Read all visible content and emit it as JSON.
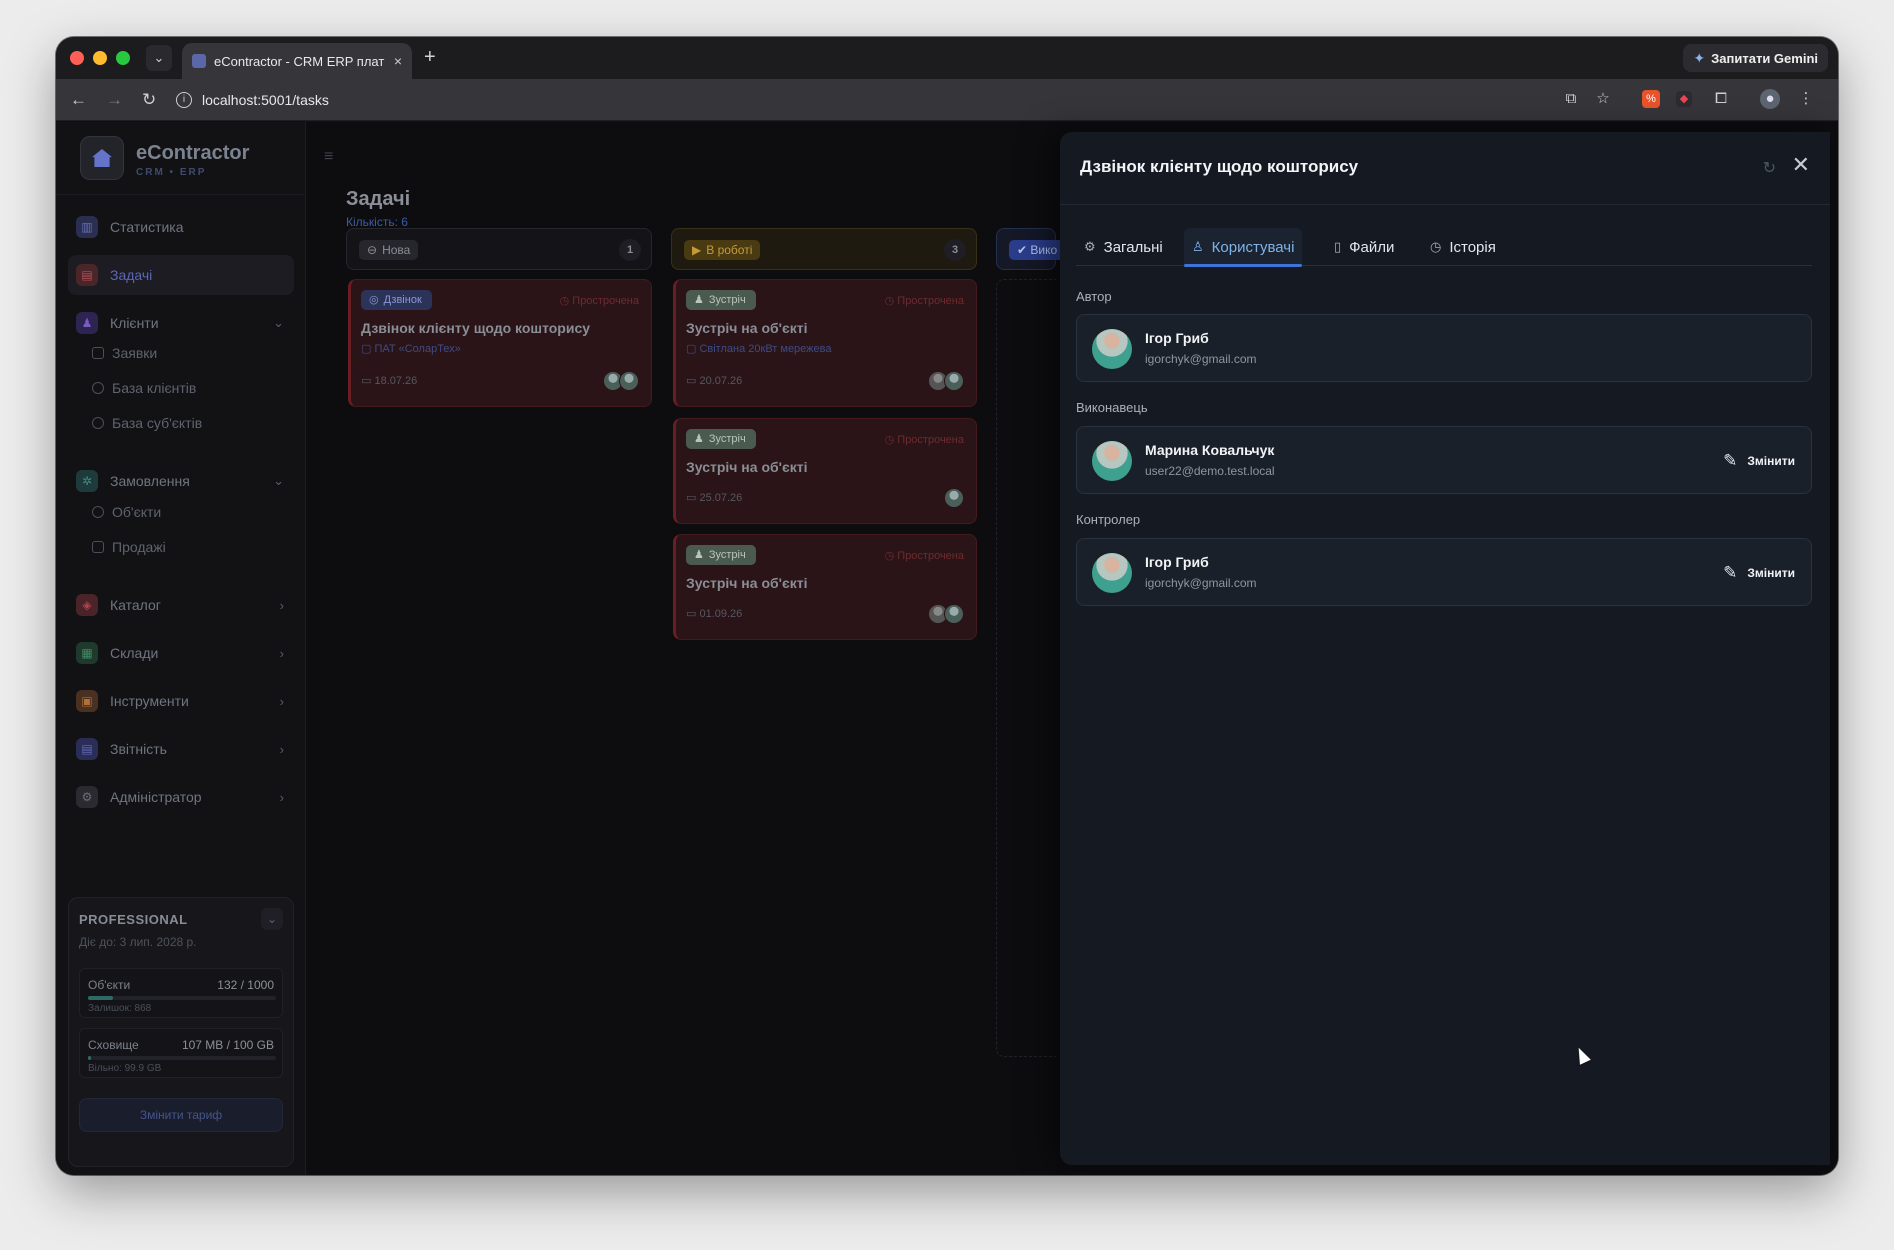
{
  "browser": {
    "tab_title": "eContractor - CRM ERP плат",
    "tab_close": "×",
    "new_tab": "+",
    "url": "localhost:5001/tasks",
    "gemini_label": "Запитати Gemini"
  },
  "sidebar": {
    "brand": "eContractor",
    "brand_sub": "CRM • ERP",
    "items": [
      {
        "label": "Статистика",
        "icon": "bar-chart-icon",
        "color": "#2a2f52"
      },
      {
        "label": "Задачі",
        "icon": "clipboard-icon",
        "color": "#4a2628"
      },
      {
        "label": "Клієнти",
        "icon": "users-icon",
        "color": "#2e2452"
      },
      {
        "label": "Замовлення",
        "icon": "gear-icon",
        "color": "#1e3a3a"
      },
      {
        "label": "Каталог",
        "icon": "box-icon",
        "color": "#4a2428"
      },
      {
        "label": "Склади",
        "icon": "warehouse-icon",
        "color": "#1f3a2c"
      },
      {
        "label": "Інструменти",
        "icon": "toolbox-icon",
        "color": "#4a3020"
      },
      {
        "label": "Звітність",
        "icon": "report-icon",
        "color": "#2a2d55"
      },
      {
        "label": "Адміністратор",
        "icon": "settings-icon",
        "color": "#2a2a30"
      }
    ],
    "clients_sub": [
      "Заявки",
      "База клієнтів",
      "База суб'єктів"
    ],
    "orders_sub": [
      "Об'єкти",
      "Продажі"
    ],
    "plan": {
      "name": "PROFESSIONAL",
      "expires": "Діє до: 3 лип. 2028 р.",
      "objects_label": "Об'єкти",
      "objects_value": "132 / 1000",
      "objects_fill": 0.132,
      "objects_rest": "Залишок: 868",
      "storage_label": "Сховище",
      "storage_value": "107 MB / 100 GB",
      "storage_fill": 0.001,
      "storage_rest": "Вільно: 99.9 GB",
      "button": "Змінити тариф"
    }
  },
  "board": {
    "title": "Задачі",
    "count": "Кількість: 6",
    "columns": [
      {
        "label": "Нова",
        "count": "1"
      },
      {
        "label": "В роботі",
        "count": "3"
      },
      {
        "label": "Вико"
      }
    ],
    "cards": [
      {
        "tag": "Дзвінок",
        "overdue": "Прострочена",
        "title": "Дзвінок клієнту щодо кошторису",
        "client": "ПАТ «СоларТех»",
        "date": "18.07.26"
      },
      {
        "tag": "Зустріч",
        "overdue": "Прострочена",
        "title": "Зустріч на об'єкті",
        "client": "Світлана 20кВт мережева",
        "date": "20.07.26"
      },
      {
        "tag": "Зустріч",
        "overdue": "Прострочена",
        "title": "Зустріч на об'єкті",
        "client": "",
        "date": "25.07.26"
      },
      {
        "tag": "Зустріч",
        "overdue": "Прострочена",
        "title": "Зустріч на об'єкті",
        "client": "",
        "date": "01.09.26"
      }
    ]
  },
  "panel": {
    "title": "Дзвінок клієнту щодо кошторису",
    "tabs": [
      "Загальні",
      "Користувачі",
      "Файли",
      "Історія"
    ],
    "sections": [
      {
        "label": "Автор",
        "name": "Ігор Гриб",
        "email": "igorchyk@gmail.com",
        "action": ""
      },
      {
        "label": "Виконавець",
        "name": "Марина Ковальчук",
        "email": "user22@demo.test.local",
        "action": "Змінити"
      },
      {
        "label": "Контролер",
        "name": "Ігор Гриб",
        "email": "igorchyk@gmail.com",
        "action": "Змінити"
      }
    ]
  }
}
